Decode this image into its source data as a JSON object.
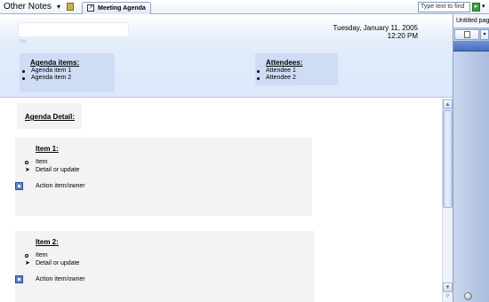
{
  "app": {
    "notebook_title": "Other Notes"
  },
  "tabs": [
    {
      "label": "Meeting Agenda"
    }
  ],
  "search": {
    "placeholder": "Type text to find"
  },
  "page_list": {
    "current_page": "Untitled pag"
  },
  "header": {
    "title_hint": "Title",
    "date": "Tuesday, January 11, 2005",
    "time": "12:20 PM",
    "agenda": {
      "heading": "Agenda items:",
      "items": [
        "Agenda item 1",
        "Agenda item 2"
      ]
    },
    "attendees": {
      "heading": "Attendees:",
      "items": [
        "Attendee 1",
        "Attendee 2"
      ]
    }
  },
  "content": {
    "detail_heading": "Agenda Detail:",
    "items": [
      {
        "heading": "Item 1:",
        "point": "Item",
        "detail": "Detail or update",
        "action": "Action item/owner"
      },
      {
        "heading": "Item 2:",
        "point": "Item",
        "detail": "Detail or update",
        "action": "Action item/owner"
      }
    ]
  },
  "icons": {
    "dropdown": "chevron-down-icon",
    "notebook": "notebook-icon",
    "page_tab": "page-icon",
    "search_go": "go-arrow-icon",
    "action_tag": "action-tag-icon"
  },
  "colors": {
    "header_bg": "#dde7fa",
    "box_bg": "#cedcf6",
    "item_bg": "#f3f3f5",
    "panel_bg": "#a9bddf",
    "page_bar": "#4a6fbd"
  }
}
